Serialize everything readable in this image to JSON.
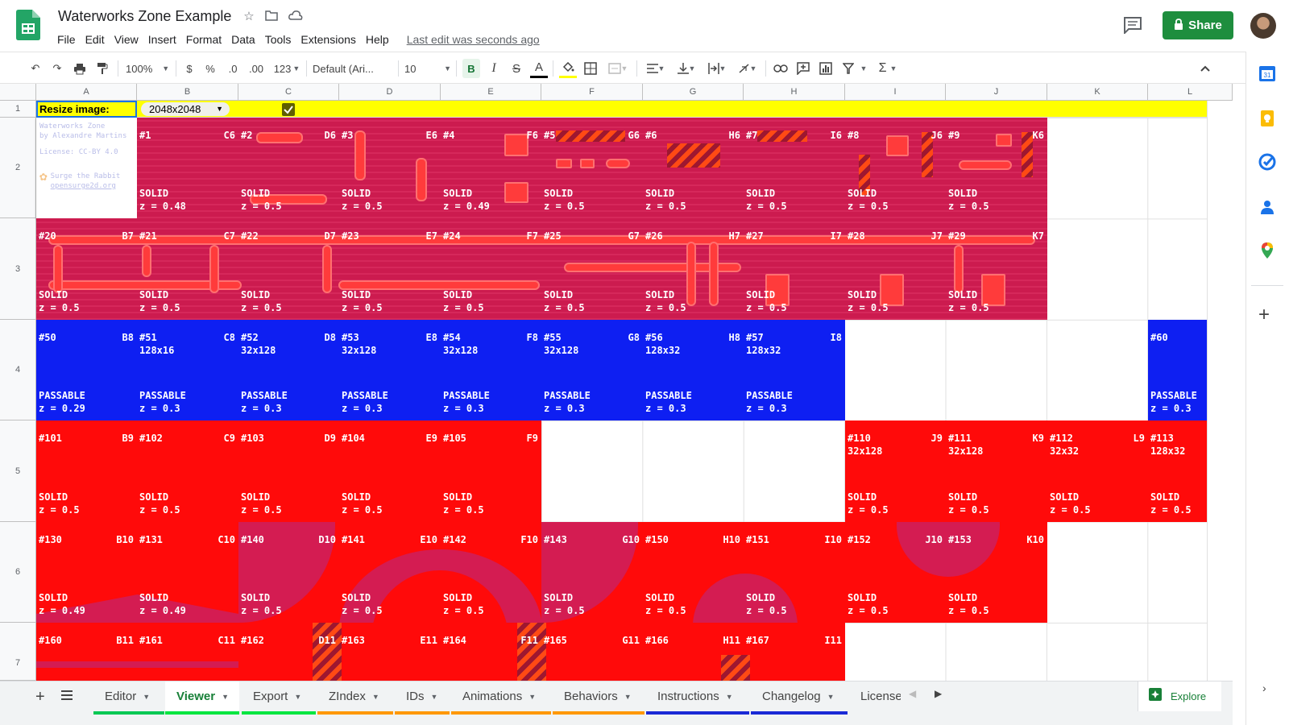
{
  "header": {
    "title": "Waterworks Zone Example",
    "menu": [
      "File",
      "Edit",
      "View",
      "Insert",
      "Format",
      "Data",
      "Tools",
      "Extensions",
      "Help"
    ],
    "last_edit": "Last edit was seconds ago",
    "share_label": "Share"
  },
  "toolbar": {
    "zoom": "100%",
    "currency": "$",
    "percent": "%",
    "dec_decrease": ".0",
    "dec_increase": ".00",
    "more_formats": "123",
    "font": "Default (Ari...",
    "font_size": "10",
    "bold": "B",
    "italic": "I",
    "strike": "S",
    "text_color": "A"
  },
  "columns": [
    "A",
    "B",
    "C",
    "D",
    "E",
    "F",
    "G",
    "H",
    "I",
    "J",
    "K",
    "L"
  ],
  "rows": [
    "1",
    "2",
    "3",
    "4",
    "5",
    "6",
    "7"
  ],
  "row1": {
    "label": "Resize image:",
    "dropdown_value": "2048x2048",
    "checkbox_checked": true,
    "highlight_color": "#ffff00"
  },
  "credit": {
    "line1": "Waterworks Zone",
    "line2": "by Alexandre Martins",
    "line3": "License: CC-BY 4.0",
    "line4": "Surge the Rabbit",
    "line5": "opensurge2d.org"
  },
  "colors": {
    "solid_pink": "#d41c52",
    "passable_blue": "#0e1ff2",
    "solid_red": "#ff0a0a",
    "share_green": "#1e8e3e"
  },
  "tiles": {
    "row2": [
      {
        "id": "#1",
        "ref": "C6",
        "type": "SOLID",
        "z": "z = 0.48"
      },
      {
        "id": "#2",
        "ref": "D6",
        "type": "SOLID",
        "z": "z = 0.5"
      },
      {
        "id": "#3",
        "ref": "E6",
        "type": "SOLID",
        "z": "z = 0.5"
      },
      {
        "id": "#4",
        "ref": "F6",
        "type": "SOLID",
        "z": "z = 0.49"
      },
      {
        "id": "#5",
        "ref": "G6",
        "type": "SOLID",
        "z": "z = 0.5"
      },
      {
        "id": "#6",
        "ref": "H6",
        "type": "SOLID",
        "z": "z = 0.5"
      },
      {
        "id": "#7",
        "ref": "I6",
        "type": "SOLID",
        "z": "z = 0.5"
      },
      {
        "id": "#8",
        "ref": "J6",
        "type": "SOLID",
        "z": "z = 0.5"
      },
      {
        "id": "#9",
        "ref": "K6",
        "type": "SOLID",
        "z": "z = 0.5"
      }
    ],
    "row3": [
      {
        "id": "#20",
        "ref": "B7",
        "type": "SOLID",
        "z": "z = 0.5"
      },
      {
        "id": "#21",
        "ref": "C7",
        "type": "SOLID",
        "z": "z = 0.5"
      },
      {
        "id": "#22",
        "ref": "D7",
        "type": "SOLID",
        "z": "z = 0.5"
      },
      {
        "id": "#23",
        "ref": "E7",
        "type": "SOLID",
        "z": "z = 0.5"
      },
      {
        "id": "#24",
        "ref": "F7",
        "type": "SOLID",
        "z": "z = 0.5"
      },
      {
        "id": "#25",
        "ref": "G7",
        "type": "SOLID",
        "z": "z = 0.5"
      },
      {
        "id": "#26",
        "ref": "H7",
        "type": "SOLID",
        "z": "z = 0.5"
      },
      {
        "id": "#27",
        "ref": "I7",
        "type": "SOLID",
        "z": "z = 0.5"
      },
      {
        "id": "#28",
        "ref": "J7",
        "type": "SOLID",
        "z": "z = 0.5"
      },
      {
        "id": "#29",
        "ref": "K7",
        "type": "SOLID",
        "z": "z = 0.5"
      }
    ],
    "row4": [
      {
        "id": "#50",
        "ref": "B8",
        "size": "",
        "type": "PASSABLE",
        "z": "z = 0.29"
      },
      {
        "id": "#51",
        "ref": "C8",
        "size": "128x16",
        "type": "PASSABLE",
        "z": "z = 0.3"
      },
      {
        "id": "#52",
        "ref": "D8",
        "size": "32x128",
        "type": "PASSABLE",
        "z": "z = 0.3"
      },
      {
        "id": "#53",
        "ref": "E8",
        "size": "32x128",
        "type": "PASSABLE",
        "z": "z = 0.3"
      },
      {
        "id": "#54",
        "ref": "F8",
        "size": "32x128",
        "type": "PASSABLE",
        "z": "z = 0.3"
      },
      {
        "id": "#55",
        "ref": "G8",
        "size": "32x128",
        "type": "PASSABLE",
        "z": "z = 0.3"
      },
      {
        "id": "#56",
        "ref": "H8",
        "size": "128x32",
        "type": "PASSABLE",
        "z": "z = 0.3"
      },
      {
        "id": "#57",
        "ref": "I8",
        "size": "128x32",
        "type": "PASSABLE",
        "z": "z = 0.3"
      },
      {
        "id": "#60",
        "ref": "",
        "size": "",
        "type": "PASSABLE",
        "z": "z = 0.3"
      }
    ],
    "row5": [
      {
        "id": "#101",
        "ref": "B9",
        "size": "",
        "type": "SOLID",
        "z": "z = 0.5"
      },
      {
        "id": "#102",
        "ref": "C9",
        "size": "",
        "type": "SOLID",
        "z": "z = 0.5"
      },
      {
        "id": "#103",
        "ref": "D9",
        "size": "",
        "type": "SOLID",
        "z": "z = 0.5"
      },
      {
        "id": "#104",
        "ref": "E9",
        "size": "",
        "type": "SOLID",
        "z": "z = 0.5"
      },
      {
        "id": "#105",
        "ref": "F9",
        "size": "",
        "type": "SOLID",
        "z": "z = 0.5"
      },
      {
        "id": "#110",
        "ref": "J9",
        "size": "32x128",
        "type": "SOLID",
        "z": "z = 0.5"
      },
      {
        "id": "#111",
        "ref": "K9",
        "size": "32x128",
        "type": "SOLID",
        "z": "z = 0.5"
      },
      {
        "id": "#112",
        "ref": "L9",
        "size": "32x32",
        "type": "SOLID",
        "z": "z = 0.5"
      },
      {
        "id": "#113",
        "ref": "",
        "size": "128x32",
        "type": "SOLID",
        "z": "z = 0.5"
      }
    ],
    "row6": [
      {
        "id": "#130",
        "ref": "B10",
        "type": "SOLID",
        "z": "z = 0.49"
      },
      {
        "id": "#131",
        "ref": "C10",
        "type": "SOLID",
        "z": "z = 0.49"
      },
      {
        "id": "#140",
        "ref": "D10",
        "type": "SOLID",
        "z": "z = 0.5"
      },
      {
        "id": "#141",
        "ref": "E10",
        "type": "SOLID",
        "z": "z = 0.5"
      },
      {
        "id": "#142",
        "ref": "F10",
        "type": "SOLID",
        "z": "z = 0.5"
      },
      {
        "id": "#143",
        "ref": "G10",
        "type": "SOLID",
        "z": "z = 0.5"
      },
      {
        "id": "#150",
        "ref": "H10",
        "type": "SOLID",
        "z": "z = 0.5"
      },
      {
        "id": "#151",
        "ref": "I10",
        "type": "SOLID",
        "z": "z = 0.5"
      },
      {
        "id": "#152",
        "ref": "J10",
        "type": "SOLID",
        "z": "z = 0.5"
      },
      {
        "id": "#153",
        "ref": "K10",
        "type": "SOLID",
        "z": "z = 0.5"
      }
    ],
    "row7": [
      {
        "id": "#160",
        "ref": "B11"
      },
      {
        "id": "#161",
        "ref": "C11"
      },
      {
        "id": "#162",
        "ref": "D11"
      },
      {
        "id": "#163",
        "ref": "E11"
      },
      {
        "id": "#164",
        "ref": "F11"
      },
      {
        "id": "#165",
        "ref": "G11"
      },
      {
        "id": "#166",
        "ref": "H11"
      },
      {
        "id": "#167",
        "ref": "I11"
      }
    ]
  },
  "sheet_tabs": [
    {
      "label": "Editor",
      "color": "#00c853"
    },
    {
      "label": "Viewer",
      "color": "#00e640"
    },
    {
      "label": "Export",
      "color": "#00e640"
    },
    {
      "label": "ZIndex",
      "color": "#ff9800"
    },
    {
      "label": "IDs",
      "color": "#ff9800"
    },
    {
      "label": "Animations",
      "color": "#ff9800"
    },
    {
      "label": "Behaviors",
      "color": "#ff9800"
    },
    {
      "label": "Instructions",
      "color": "#1a2ad6"
    },
    {
      "label": "Changelog",
      "color": "#1a2ad6"
    },
    {
      "label": "License",
      "color": "#1a2ad6"
    }
  ],
  "explore_label": "Explore"
}
